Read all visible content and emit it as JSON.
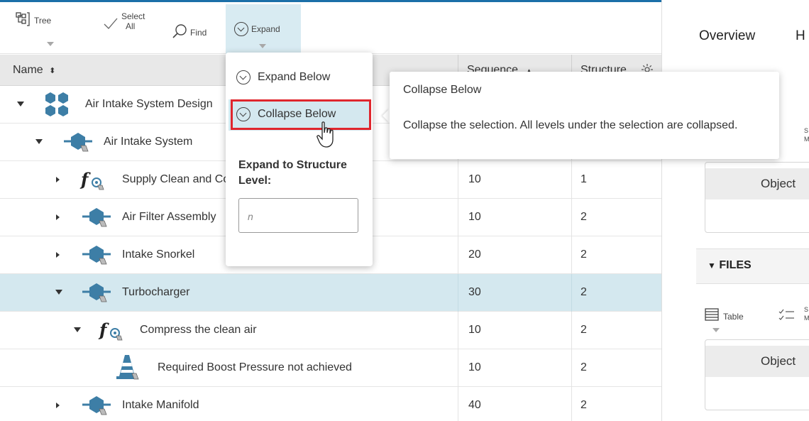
{
  "toolbar": {
    "tree_label": "Tree",
    "select_label_1": "Select",
    "select_label_2": "All",
    "find_label": "Find",
    "expand_label": "Expand"
  },
  "table": {
    "headers": {
      "name": "Name",
      "sequence": "Sequence",
      "structure": "Structure"
    },
    "sort_indicator": "▲",
    "rows": [
      {
        "name": "Air Intake System Design",
        "sequence": "",
        "level": ""
      },
      {
        "name": "Air Intake System",
        "sequence": "",
        "level": ""
      },
      {
        "name": "Supply Clean and Compressed Air",
        "sequence": "10",
        "level": "1"
      },
      {
        "name": "Air Filter Assembly",
        "sequence": "10",
        "level": "2"
      },
      {
        "name": "Intake Snorkel",
        "sequence": "20",
        "level": "2"
      },
      {
        "name": "Turbocharger",
        "sequence": "30",
        "level": "2"
      },
      {
        "name": "Compress the clean air",
        "sequence": "10",
        "level": "2"
      },
      {
        "name": "Required Boost Pressure not achieved",
        "sequence": "10",
        "level": "2"
      },
      {
        "name": "Intake Manifold",
        "sequence": "40",
        "level": "2"
      }
    ]
  },
  "menu": {
    "expand_below": "Expand Below",
    "collapse_below": "Collapse Below",
    "expand_to_label": "Expand to Structure Level:",
    "level_placeholder": "n"
  },
  "tooltip": {
    "title": "Collapse Below",
    "body": "Collapse the selection. All levels under the selection are collapsed."
  },
  "right_panel": {
    "tab_overview": "Overview",
    "tab_h": "H",
    "object_header_1": "Object",
    "files_label": "FILES",
    "table_label": "Table",
    "object_header_2": "Object"
  },
  "colors": {
    "accent": "#1b6fa8",
    "selection": "#d4e8ef",
    "highlight_red": "#e0262d",
    "icon_blue": "#3d7ea6"
  }
}
